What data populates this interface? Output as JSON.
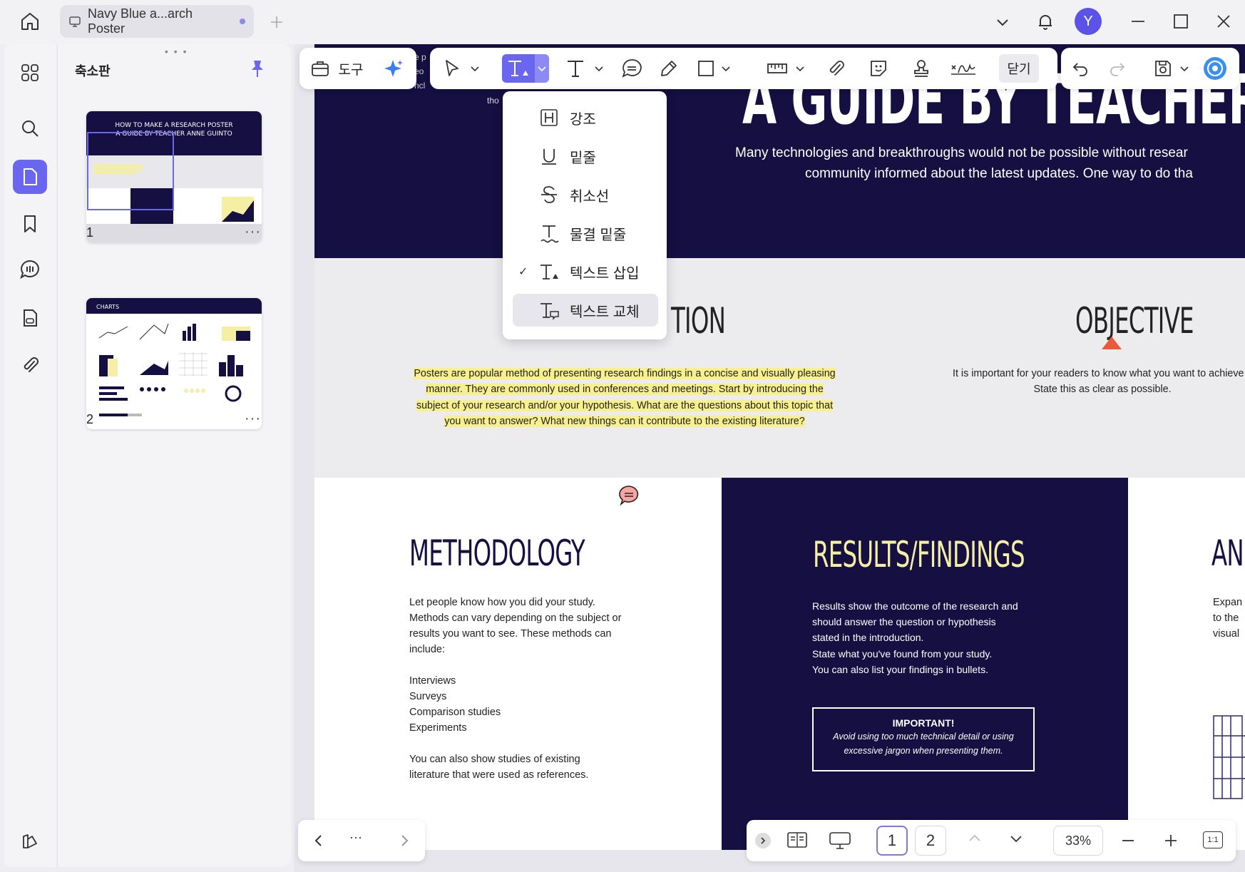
{
  "app": {
    "tab_title": "Navy Blue a...arch Poster",
    "avatar_initial": "Y"
  },
  "thumbnails": {
    "title": "축소판",
    "pages": [
      {
        "number": "1"
      },
      {
        "number": "2"
      }
    ],
    "more_label": "···"
  },
  "toolbar": {
    "tools_label": "도구",
    "close_label": "닫기"
  },
  "dropdown": {
    "items": [
      {
        "label": "강조",
        "icon": "highlight-icon",
        "checked": false
      },
      {
        "label": "밑줄",
        "icon": "underline-icon",
        "checked": false
      },
      {
        "label": "취소선",
        "icon": "strikethrough-icon",
        "checked": false
      },
      {
        "label": "물결 밑줄",
        "icon": "wavy-underline-icon",
        "checked": false
      },
      {
        "label": "텍스트 삽입",
        "icon": "text-insert-icon",
        "checked": true
      },
      {
        "label": "텍스트 교체",
        "icon": "text-replace-icon",
        "checked": false
      }
    ],
    "check_mark": "✓"
  },
  "poster": {
    "heading_fragment": "A GUIDE BY TEACHER A",
    "intro_text_line1": "Many technologies and breakthroughs would not be possible without resear",
    "intro_text_line2": "community informed about the latest updates. One way to do tha",
    "left_fragments": [
      "e p",
      "eo",
      "ncl",
      "tho"
    ],
    "introduction_fragment": "TION",
    "introduction_body": "Posters are popular method of presenting research findings in a concise and visually pleasing manner. They are commonly used in conferences and meetings. Start by introducing the subject of your research and/or your hypothesis. What are the questions about this topic that you want to answer? What new things can it contribute to the existing literature?",
    "objective_title": "OBJECTIVE",
    "objective_body_line1": "It is important for your readers to know what you want to achieve w",
    "objective_body_line2": "State this as clear as possible.",
    "methodology_title": "METHODOLOGY",
    "methodology_body": [
      "Let people know how you did your study.",
      "Methods can vary depending on the subject or",
      "results you want to see. These methods can",
      "include:",
      "",
      "Interviews",
      "Surveys",
      "Comparison studies",
      "Experiments",
      "",
      "You can also show studies of existing",
      "literature that were used as references."
    ],
    "results_title": "RESULTS/FINDINGS",
    "results_body": [
      "Results show the outcome of the research and",
      "should answer the question or hypothesis",
      "stated in the introduction.",
      "State what you've found from your study.",
      "You can also list your findings in bullets."
    ],
    "important_title": "IMPORTANT!",
    "important_body_line1": "Avoid using too much technical detail or using",
    "important_body_line2": "excessive jargon when presenting them.",
    "analysis_fragment": "AN",
    "analysis_body": [
      "Expan",
      "to the",
      "visual"
    ]
  },
  "thumb1": {
    "title_line1": "HOW TO MAKE A RESEARCH POSTER",
    "title_line2": "A GUIDE BY TEACHER ANNE GUINTO"
  },
  "thumb2": {
    "header": "CHARTS"
  },
  "bottom": {
    "nav_more": "···",
    "pages": [
      "1",
      "2"
    ],
    "zoom": "33%",
    "fit_label": "1:1"
  },
  "colors": {
    "navy": "#150f42",
    "accent": "#6a66f0",
    "highlight": "#f7f08c",
    "results_title": "#f4efa3"
  }
}
